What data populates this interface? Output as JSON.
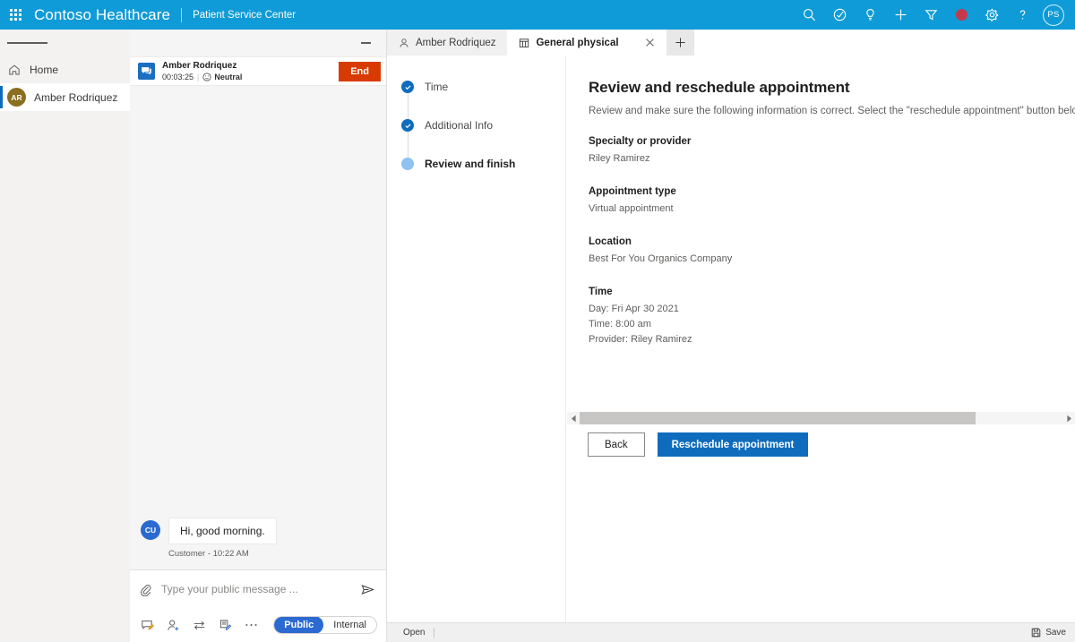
{
  "topbar": {
    "waffle_label": "app-launcher",
    "brand": "Contoso Healthcare",
    "subbrand": "Patient Service Center",
    "icons": [
      "search-icon",
      "assistant-icon",
      "insights-icon",
      "add-icon",
      "filter-icon",
      "record-icon",
      "settings-icon",
      "help-icon"
    ],
    "avatar_initials": "PS",
    "accent_color": "#0f9bd7",
    "record_color": "#c5394a"
  },
  "sidebar": {
    "menu_label": "hamburger-menu",
    "items": [
      {
        "label": "Home",
        "icon": "home-icon",
        "selected": false
      },
      {
        "label": "Amber Rodriquez",
        "icon": "avatar",
        "initials": "AR",
        "selected": true
      }
    ]
  },
  "chat": {
    "minimize_label": "minimize",
    "conversation": {
      "name": "Amber Rodriquez",
      "timer": "00:03:25",
      "separator": "|",
      "sentiment": "Neutral",
      "end_label": "End",
      "end_color": "#d83b01"
    },
    "messages": [
      {
        "initials": "CU",
        "text": "Hi, good morning.",
        "stamp": "Customer - 10:22 AM"
      }
    ],
    "composer": {
      "attach_label": "attach-file",
      "placeholder": "Type your public message ...",
      "value": "",
      "send_label": "send",
      "tools": [
        "quick-replies-icon",
        "add-participant-icon",
        "transfer-icon",
        "notes-icon",
        "more-icon"
      ],
      "toggle": {
        "options": [
          "Public",
          "Internal"
        ],
        "selected": "Public"
      }
    }
  },
  "tabs": [
    {
      "label": "Amber Rodriquez",
      "icon": "person-icon",
      "active": false,
      "closable": false
    },
    {
      "label": "General physical",
      "icon": "calendar-icon",
      "active": true,
      "closable": true
    }
  ],
  "tab_add_label": "new-tab",
  "stepper": {
    "steps": [
      {
        "label": "Time",
        "state": "done"
      },
      {
        "label": "Additional Info",
        "state": "done"
      },
      {
        "label": "Review and finish",
        "state": "current"
      }
    ]
  },
  "page": {
    "title": "Review and reschedule appointment",
    "description": "Review and make sure the following information is correct. Select the \"reschedule appointment\" button below to update the appointment.",
    "fields": [
      {
        "label": "Specialty or provider",
        "value": "Riley Ramirez"
      },
      {
        "label": "Appointment type",
        "value": "Virtual appointment"
      },
      {
        "label": "Location",
        "value": "Best For You Organics Company"
      },
      {
        "label": "Time",
        "value": "Day: Fri Apr 30 2021\nTime: 8:00 am\nProvider: Riley Ramirez"
      }
    ],
    "scrollbar": {
      "left_arrow": "◀",
      "right_arrow": "▶",
      "thumb_percent": 82
    },
    "back_label": "Back",
    "primary_label": "Reschedule appointment",
    "primary_color": "#0f6cbd"
  },
  "statusbar": {
    "open_label": "Open",
    "save_label": "Save",
    "save_icon": "save-icon"
  }
}
